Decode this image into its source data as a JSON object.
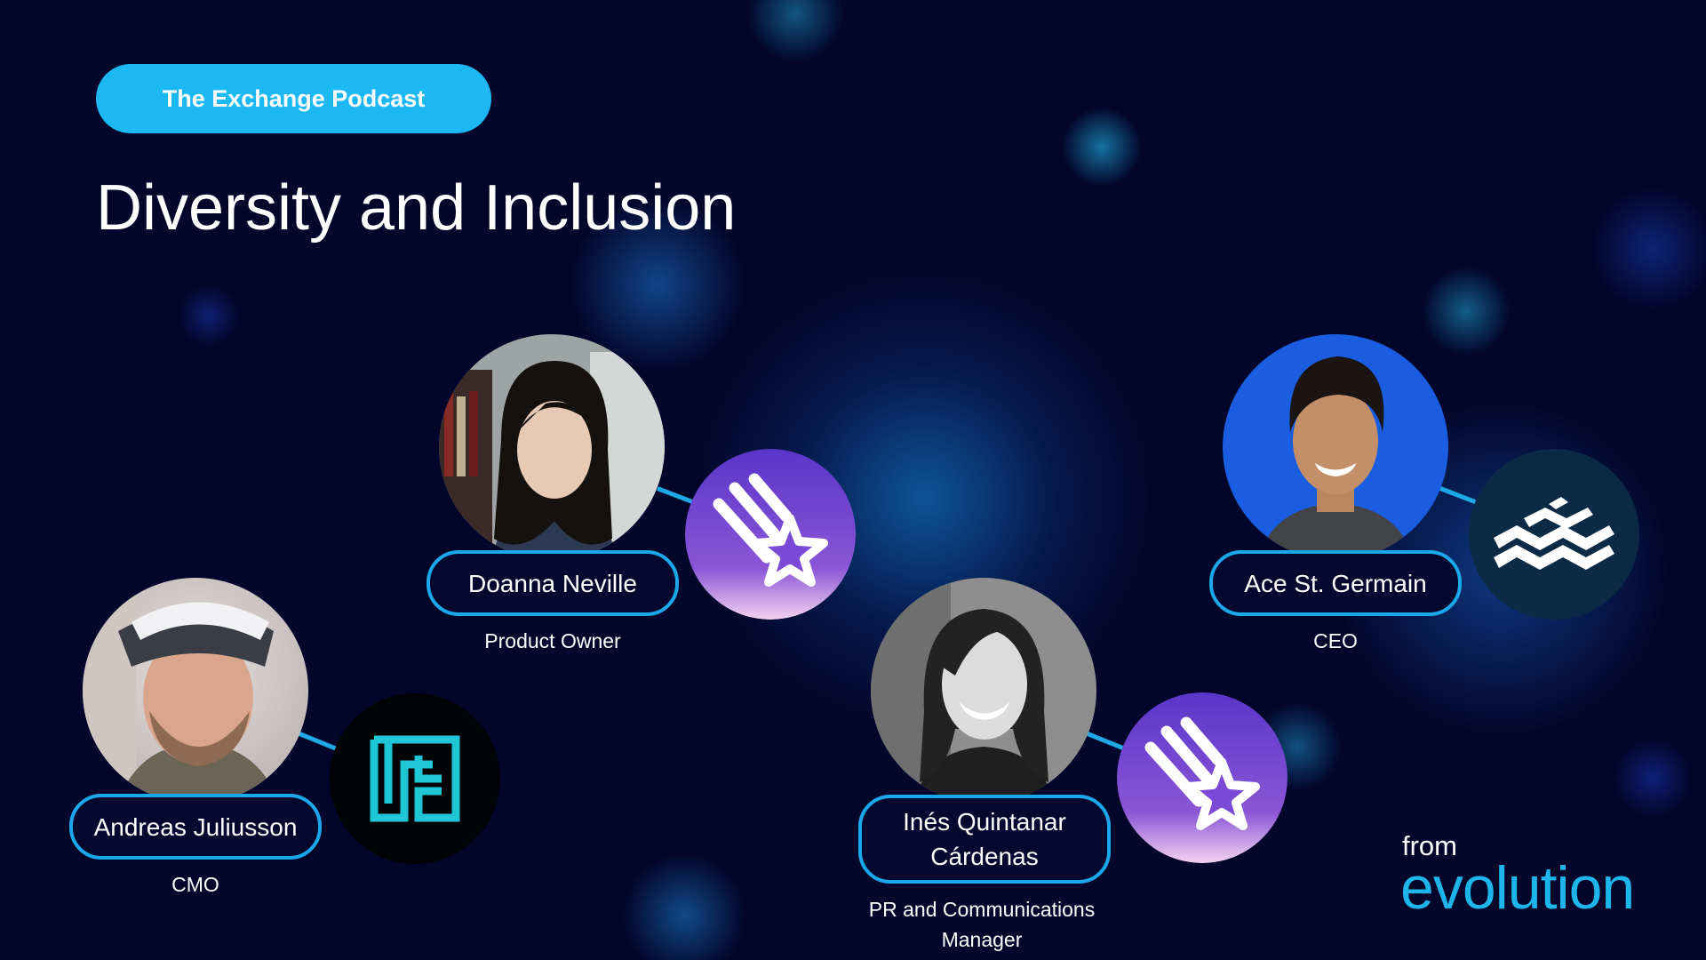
{
  "header": {
    "badge_label": "The Exchange Podcast",
    "title": "Diversity and Inclusion"
  },
  "speakers": [
    {
      "name": "Andreas Juliusson",
      "role": "CMO",
      "logo_icon": "ftg-maze-logo-icon"
    },
    {
      "name": "Doanna Neville",
      "role": "Product Owner",
      "logo_icon": "shooting-star-logo-icon"
    },
    {
      "name": "Inés Quintanar Cárdenas",
      "role": "PR and Communications Manager",
      "logo_icon": "shooting-star-logo-icon"
    },
    {
      "name": "Ace St. Germain",
      "role": "CEO",
      "logo_icon": "stacked-waves-logo-icon"
    }
  ],
  "brand": {
    "prefix": "from",
    "wordmark": "evolution"
  },
  "colors": {
    "background": "#03062a",
    "accent": "#1cb8f3",
    "pill_border": "#1aa8ea",
    "star_logo_purple": "#6a3fd0",
    "ftg_logo_teal": "#1fc6d6",
    "waves_logo_bg": "#0b2a45"
  }
}
